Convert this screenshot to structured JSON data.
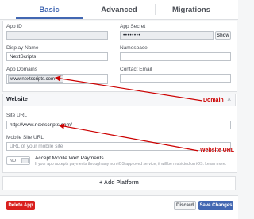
{
  "tabs": {
    "basic": "Basic",
    "advanced": "Advanced",
    "migrations": "Migrations"
  },
  "basic": {
    "app_id_label": "App ID",
    "app_secret_label": "App Secret",
    "app_secret_value": "••••••••",
    "show_label": "Show",
    "display_name_label": "Display Name",
    "display_name_value": "NextScripts",
    "namespace_label": "Namespace",
    "app_domains_label": "App Domains",
    "app_domain_tag": "www.nextscripts.com",
    "app_domain_remove": "×",
    "contact_email_label": "Contact Email"
  },
  "website": {
    "title": "Website",
    "close": "×",
    "site_url_label": "Site URL",
    "site_url_value": "http://www.nextscripts.com/",
    "mobile_site_url_label": "Mobile Site URL",
    "mobile_site_url_placeholder": "URL of your mobile site",
    "toggle_label": "NO",
    "payments_label": "Accept Mobile Web Payments",
    "payments_note": "If your app accepts payments through any non-iOS approved service, it will be restricted on iOS. Learn more."
  },
  "add_platform": "+ Add Platform",
  "footer": {
    "delete": "Delete App",
    "discard": "Discard",
    "save": "Save Changes"
  },
  "annotations": {
    "domain": "Domain",
    "website_url": "Website URL"
  },
  "colors": {
    "accent": "#4267b2",
    "delete": "#d9201e",
    "annotation": "#cc0000"
  }
}
